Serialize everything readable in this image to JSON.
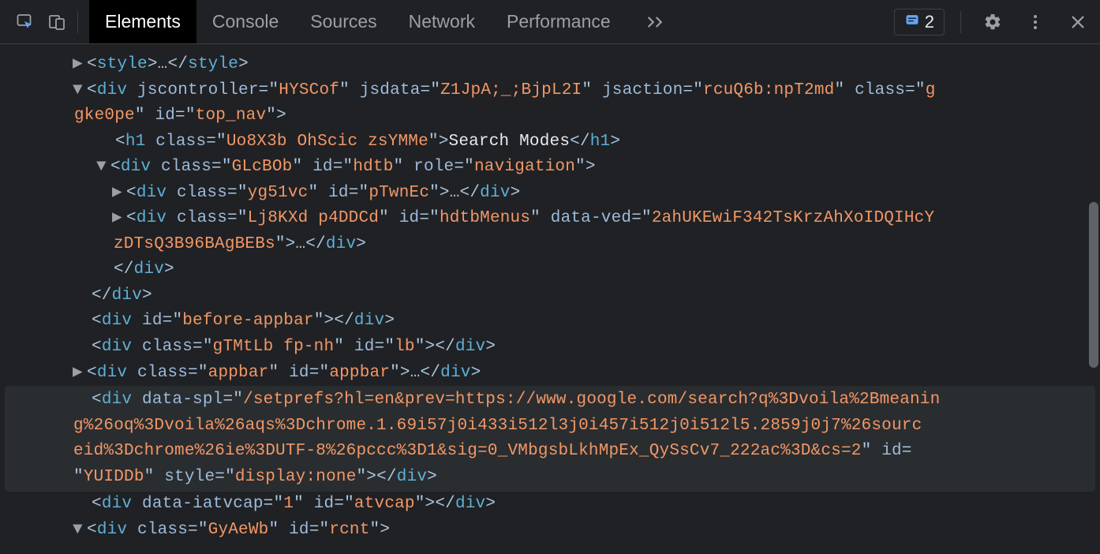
{
  "toolbar": {
    "tabs": [
      "Elements",
      "Console",
      "Sources",
      "Network",
      "Performance"
    ],
    "issues_count": "2"
  },
  "dom": {
    "style_tag": "style",
    "ellipsis": "…",
    "style_close": "style",
    "div_open_tag": "div",
    "jscontroller_attr": "jscontroller",
    "jscontroller_val": "HYSCof",
    "jsdata_attr": "jsdata",
    "jsdata_val": "Z1JpA;_;BjpL2I",
    "jsaction_attr": "jsaction",
    "jsaction_val": "rcuQ6b:npT2md",
    "class_attr": "class",
    "topnav_class_val": "gke0pe",
    "id_attr": "id",
    "topnav_id_val": "top_nav",
    "h1_tag": "h1",
    "h1_class_val": "Uo8X3b OhScic zsYMMe",
    "h1_text": "Search Modes",
    "glcbob_class_val": "GLcBOb",
    "hdtb_id_val": "hdtb",
    "role_attr": "role",
    "role_val": "navigation",
    "yg51vc_class_val": "yg51vc",
    "ptwnec_id_val": "pTwnEc",
    "lj8kxd_class_val": "Lj8KXd p4DDCd",
    "hdtbmenus_id_val": "hdtbMenus",
    "dataved_attr": "data-ved",
    "dataved_val_part1": "2ahUKEwiF342TsKrzAhXoIDQIHcY",
    "dataved_val_part2": "zDTsQ3B96BAgBEBs",
    "div_close_tag": "div",
    "before_appbar_id_val": "before-appbar",
    "gtmtlb_class_val": "gTMtLb fp-nh",
    "lb_id_val": "lb",
    "appbar_class_val": "appbar",
    "appbar_id_val": "appbar",
    "dataspl_attr": "data-spl",
    "dataspl_val_part1": "/setprefs?hl=en&prev=https://www.google.com/search?q%3Dvoila%2Bmeanin",
    "dataspl_val_part2": "g%26oq%3Dvoila%26aqs%3Dchrome.1.69i57j0i433i512l3j0i457i512j0i512l5.2859j0j7%26sourc",
    "dataspl_val_part3": "eid%3Dchrome%26ie%3DUTF-8%26pccc%3D1&sig=0_VMbgsbLkhMpEx_QySsCv7_222ac%3D&cs=2",
    "yuiddb_id_val": "YUIDDb",
    "style_attr": "style",
    "style_val": "display:none",
    "dataiatvcap_attr": "data-iatvcap",
    "dataiatvcap_val": "1",
    "atvcap_id_val": "atvcap",
    "gyaewb_class_val": "GyAeWb",
    "rcnt_id_val": "rcnt"
  }
}
